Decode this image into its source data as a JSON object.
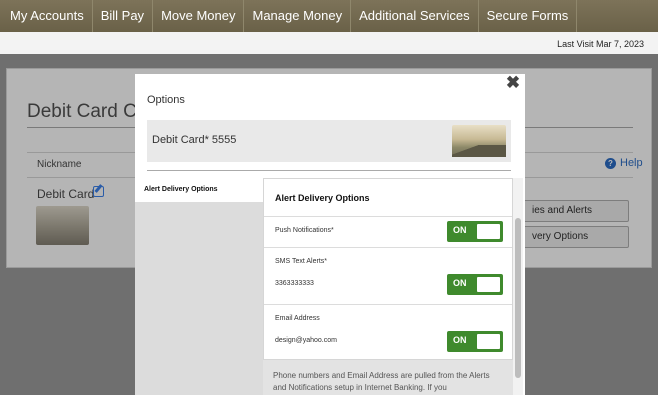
{
  "nav": {
    "items": [
      "My Accounts",
      "Bill Pay",
      "Move Money",
      "Manage Money",
      "Additional Services",
      "Secure Forms"
    ]
  },
  "header": {
    "last_visit": "Last Visit Mar 7, 2023"
  },
  "background": {
    "page_title": "Debit Card Co",
    "help": "Help",
    "column_header": "Nickname",
    "card_nickname": "Debit Card",
    "side_buttons": [
      "ies and Alerts",
      "very Options"
    ]
  },
  "modal": {
    "title": "Options",
    "close": "✖",
    "card_name": "Debit Card* 5555",
    "left_tab": "Alert Delivery Options",
    "section_title": "Alert Delivery Options",
    "push": {
      "label": "Push Notifications*",
      "state": "ON"
    },
    "sms": {
      "label": "SMS Text Alerts*",
      "value": "3363333333",
      "state": "ON"
    },
    "email": {
      "label": "Email Address",
      "value": "design@yahoo.com",
      "state": "ON"
    },
    "footnote": "Phone numbers and Email Address are pulled from the Alerts and Notifications setup in Internet Banking. If you"
  },
  "colors": {
    "toggle_on": "#3f8a2d",
    "nav_bg": "#6f6650",
    "link": "#1f4d8c"
  }
}
